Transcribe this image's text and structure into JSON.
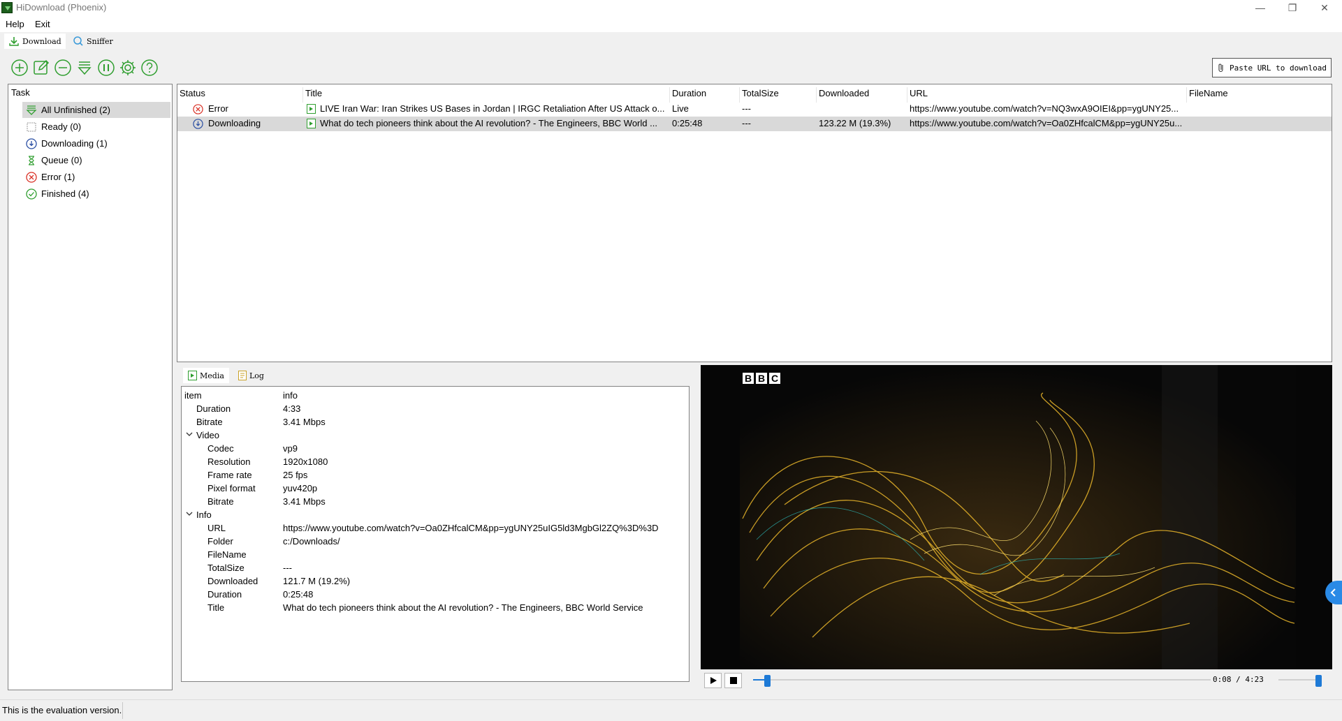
{
  "window": {
    "title": "HiDownload (Phoenix)",
    "minimize": "—",
    "restore": "❐",
    "close": "✕"
  },
  "menu": {
    "items": [
      "Help",
      "Exit"
    ]
  },
  "mode_tabs": [
    {
      "label": "Download",
      "active": true
    },
    {
      "label": "Sniffer",
      "active": false
    }
  ],
  "toolbar": {
    "icons": [
      "add-icon",
      "edit-icon",
      "remove-icon",
      "filter-icon",
      "pause-icon",
      "settings-icon",
      "help-icon"
    ],
    "paste_label": "Paste URL to download"
  },
  "task_panel": {
    "header": "Task",
    "items": [
      {
        "label": "All Unfinished (2)",
        "icon": "filter-icon",
        "selected": true
      },
      {
        "label": "Ready (0)",
        "icon": "ready-icon",
        "selected": false
      },
      {
        "label": "Downloading (1)",
        "icon": "downloading-icon",
        "selected": false
      },
      {
        "label": "Queue (0)",
        "icon": "queue-icon",
        "selected": false
      },
      {
        "label": "Error (1)",
        "icon": "error-icon",
        "selected": false
      },
      {
        "label": "Finished (4)",
        "icon": "finished-icon",
        "selected": false
      }
    ]
  },
  "download_list": {
    "columns": [
      "Status",
      "Title",
      "Duration",
      "TotalSize",
      "Downloaded",
      "URL",
      "FileName"
    ],
    "rows": [
      {
        "status": "Error",
        "title": "LIVE Iran War: Iran Strikes US Bases in Jordan | IRGC Retaliation After US Attack o...",
        "duration": "Live",
        "total_size": "---",
        "downloaded": "",
        "url": "https://www.youtube.com/watch?v=NQ3wxA9OIEI&pp=ygUNY25...",
        "filename": "",
        "selected": false
      },
      {
        "status": "Downloading",
        "title": "What do tech pioneers think about the AI revolution? - The Engineers, BBC World ...",
        "duration": "0:25:48",
        "total_size": "---",
        "downloaded": "123.22 M (19.3%)",
        "url": "https://www.youtube.com/watch?v=Oa0ZHfcalCM&pp=ygUNY25u...",
        "filename": "",
        "selected": true
      }
    ]
  },
  "detail_tabs": [
    {
      "label": "Media",
      "active": true
    },
    {
      "label": "Log",
      "active": false
    }
  ],
  "media_info": {
    "header": {
      "item": "item",
      "info": "info"
    },
    "rows": [
      {
        "key": "Duration",
        "value": "4:33",
        "level": 1
      },
      {
        "key": "Bitrate",
        "value": "3.41 Mbps",
        "level": 1
      },
      {
        "key": "Video",
        "value": "",
        "level": 1,
        "group": true
      },
      {
        "key": "Codec",
        "value": "vp9",
        "level": 2
      },
      {
        "key": "Resolution",
        "value": "1920x1080",
        "level": 2
      },
      {
        "key": "Frame rate",
        "value": "25 fps",
        "level": 2
      },
      {
        "key": "Pixel format",
        "value": "yuv420p",
        "level": 2
      },
      {
        "key": "Bitrate",
        "value": "3.41 Mbps",
        "level": 2
      },
      {
        "key": "Info",
        "value": "",
        "level": 1,
        "group": true
      },
      {
        "key": "URL",
        "value": "https://www.youtube.com/watch?v=Oa0ZHfcalCM&pp=ygUNY25uIG5ld3MgbGl2ZQ%3D%3D",
        "level": 2
      },
      {
        "key": "Folder",
        "value": "c:/Downloads/",
        "level": 2
      },
      {
        "key": "FileName",
        "value": "",
        "level": 2
      },
      {
        "key": "TotalSize",
        "value": "---",
        "level": 2
      },
      {
        "key": "Downloaded",
        "value": "121.7 M (19.2%)",
        "level": 2
      },
      {
        "key": "Duration",
        "value": "0:25:48",
        "level": 2
      },
      {
        "key": "Title",
        "value": "What do tech pioneers think about the AI revolution? - The Engineers, BBC World Service",
        "level": 2
      }
    ]
  },
  "player": {
    "logo_letters": [
      "B",
      "B",
      "C"
    ],
    "time": "0:08 / 4:23",
    "progress": 0.031,
    "volume": 0.95
  },
  "status_bar": {
    "text": "This is the evaluation version."
  },
  "colors": {
    "accent": "#1e7ad6",
    "icon_green": "#2f9e2f",
    "error_red": "#d93025",
    "downloading_blue": "#2b4fa3"
  }
}
